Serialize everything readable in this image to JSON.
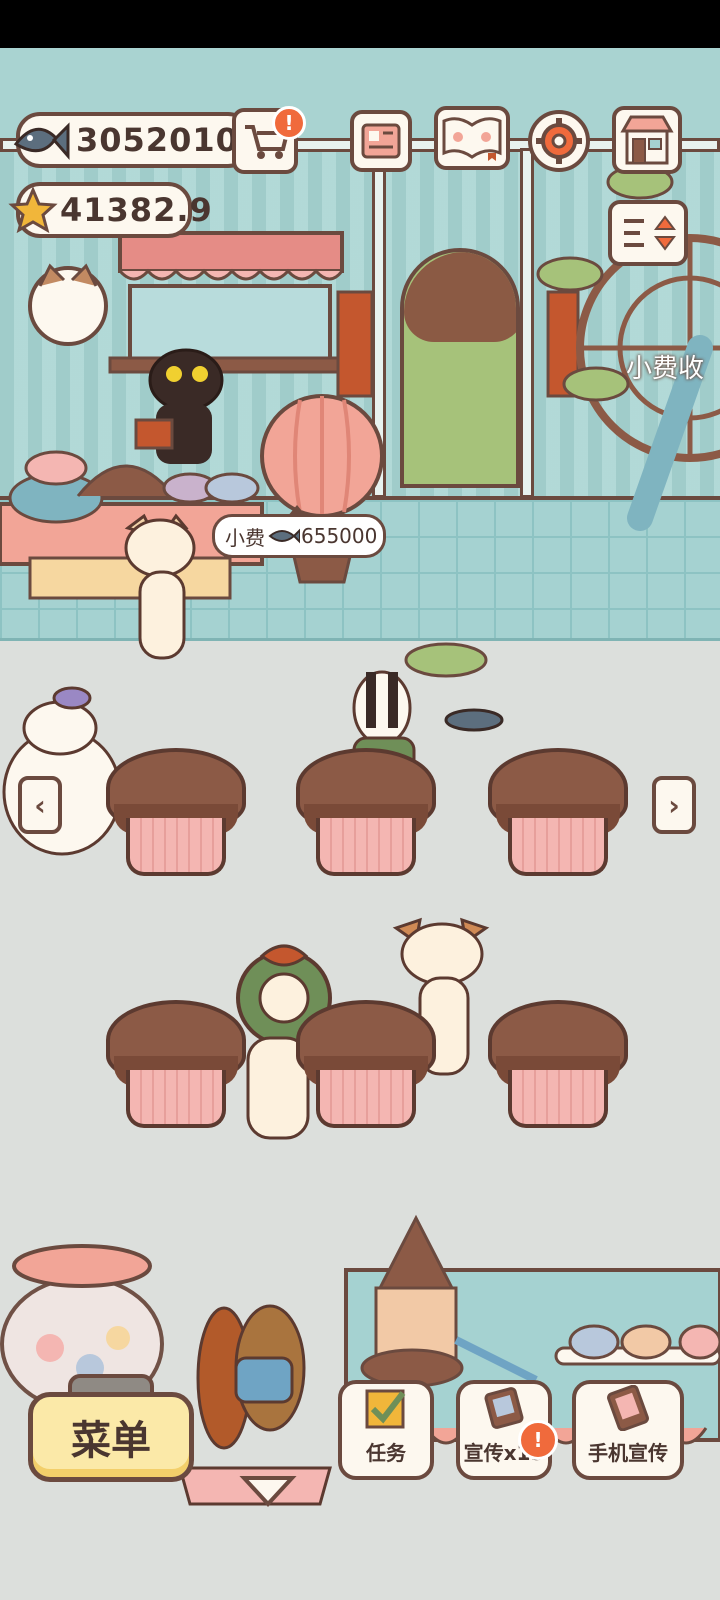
{
  "hud": {
    "fish_count": "3052010",
    "star_count": "41382.9"
  },
  "icons": {
    "fish": "fish-icon",
    "star": "star-icon",
    "cart": "cart-icon",
    "newspaper": "newspaper-icon",
    "book": "paw-book-icon",
    "settings": "gear-icon",
    "shop": "shop-icon",
    "sort": "sort-icon"
  },
  "tip_bubble": {
    "prefix": "小费",
    "amount": "655000"
  },
  "side_label": "小费收",
  "badges": {
    "cart": "!",
    "promo": "!"
  },
  "bottom_bar": {
    "menu_label": "菜单",
    "tasks_label": "任务",
    "promo_label": "宣传x15",
    "phone_promo_label": "手机宣传"
  },
  "colors": {
    "outline": "#6b4a3f",
    "wall": "#a9d3d1",
    "floor": "#dcdfdc",
    "menu_yellow": "#fbe9a8",
    "badge_orange": "#f06a3c"
  }
}
